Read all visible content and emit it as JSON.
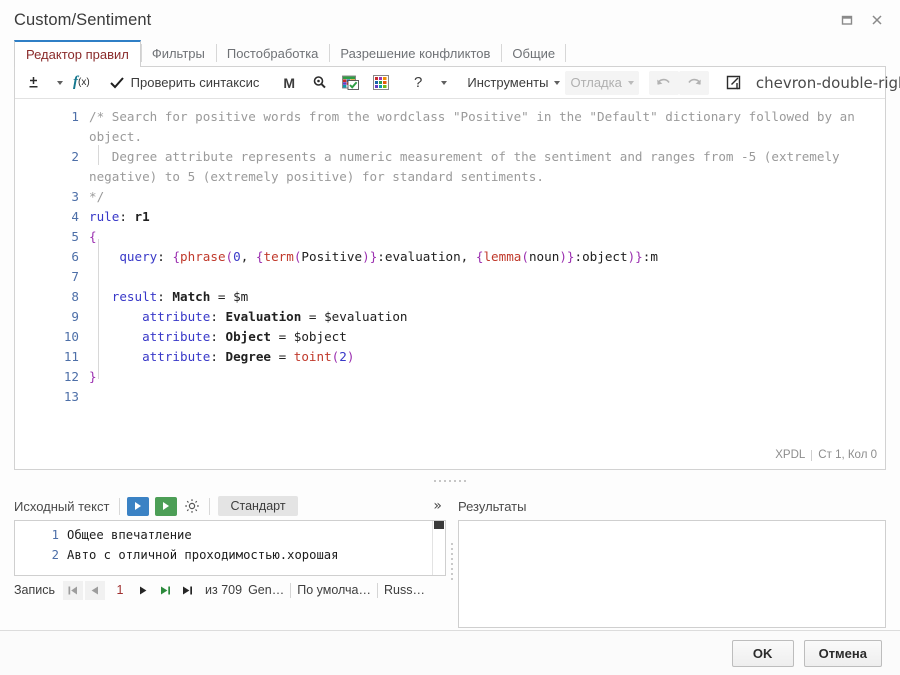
{
  "window": {
    "title": "Custom/Sentiment",
    "restore_icon": "restore-window-icon",
    "close_icon": "close-icon"
  },
  "tabs": [
    {
      "label": "Редактор правил",
      "active": true
    },
    {
      "label": "Фильтры",
      "active": false
    },
    {
      "label": "Постобработка",
      "active": false
    },
    {
      "label": "Разрешение конфликтов",
      "active": false
    },
    {
      "label": "Общие",
      "active": false
    }
  ],
  "toolbar": {
    "plusminus_icon": "plus-minus-icon",
    "function_icon": "function-fx-icon",
    "check_syntax_label": "Проверить синтаксис",
    "check_icon": "checkmark-icon",
    "macro_icon": "M",
    "search_icon": "search-icon",
    "dictionary_icon": "dictionary-check-icon",
    "palette_icon": "color-grid-icon",
    "help_icon": "?",
    "tools_label": "Инструменты",
    "debug_label": "Отладка",
    "undo_icon": "undo-icon",
    "redo_icon": "redo-icon",
    "popout_icon": "open-external-icon",
    "overflow_icon": "chevron-double-right-icon",
    "panel_icon": "toggle-panel-icon"
  },
  "editor": {
    "status_language": "XPDL",
    "status_position": "Ст 1, Кол 0",
    "lines": [
      {
        "number": "1",
        "tokens": [
          {
            "t": "/* Search for positive words from the wordclass \"Positive\" in the \"Default\" dictionary followed by an object.",
            "c": "cmt"
          }
        ]
      },
      {
        "number": "2",
        "tokens": [
          {
            "t": "   Degree attribute represents a numeric measurement of the sentiment and ranges from -5 (extremely negative) to 5 (extremely positive) for standard sentiments.",
            "c": "cmt"
          }
        ]
      },
      {
        "number": "3",
        "tokens": [
          {
            "t": "*/",
            "c": "cmt"
          }
        ]
      },
      {
        "number": "4",
        "tokens": [
          {
            "t": "rule",
            "c": "kw"
          },
          {
            "t": ": ",
            "c": "plain"
          },
          {
            "t": "r1",
            "c": "bold-id"
          }
        ]
      },
      {
        "number": "5",
        "tokens": [
          {
            "t": "{",
            "c": "punct"
          }
        ]
      },
      {
        "number": "6",
        "tokens": [
          {
            "t": "    ",
            "c": "plain"
          },
          {
            "t": "query",
            "c": "kw"
          },
          {
            "t": ": ",
            "c": "plain"
          },
          {
            "t": "{",
            "c": "punct"
          },
          {
            "t": "phrase",
            "c": "fn"
          },
          {
            "t": "(",
            "c": "punct"
          },
          {
            "t": "0",
            "c": "num"
          },
          {
            "t": ", ",
            "c": "plain"
          },
          {
            "t": "{",
            "c": "punct"
          },
          {
            "t": "term",
            "c": "fn"
          },
          {
            "t": "(",
            "c": "punct"
          },
          {
            "t": "Positive",
            "c": "plain"
          },
          {
            "t": ")",
            "c": "punct"
          },
          {
            "t": "}",
            "c": "punct"
          },
          {
            "t": ":evaluation, ",
            "c": "plain"
          },
          {
            "t": "{",
            "c": "punct"
          },
          {
            "t": "lemma",
            "c": "fn"
          },
          {
            "t": "(",
            "c": "punct"
          },
          {
            "t": "noun",
            "c": "plain"
          },
          {
            "t": ")",
            "c": "punct"
          },
          {
            "t": "}",
            "c": "punct"
          },
          {
            "t": ":object",
            "c": "plain"
          },
          {
            "t": ")",
            "c": "punct"
          },
          {
            "t": "}",
            "c": "punct"
          },
          {
            "t": ":m",
            "c": "plain"
          }
        ]
      },
      {
        "number": "7",
        "tokens": []
      },
      {
        "number": "8",
        "tokens": [
          {
            "t": "   ",
            "c": "plain"
          },
          {
            "t": "result",
            "c": "kw"
          },
          {
            "t": ": ",
            "c": "plain"
          },
          {
            "t": "Match",
            "c": "bold-id"
          },
          {
            "t": " = ",
            "c": "plain"
          },
          {
            "t": "$m",
            "c": "var"
          }
        ]
      },
      {
        "number": "9",
        "tokens": [
          {
            "t": "       ",
            "c": "plain"
          },
          {
            "t": "attribute",
            "c": "kw"
          },
          {
            "t": ": ",
            "c": "plain"
          },
          {
            "t": "Evaluation",
            "c": "bold-id"
          },
          {
            "t": " = ",
            "c": "plain"
          },
          {
            "t": "$evaluation",
            "c": "var"
          }
        ]
      },
      {
        "number": "10",
        "tokens": [
          {
            "t": "       ",
            "c": "plain"
          },
          {
            "t": "attribute",
            "c": "kw"
          },
          {
            "t": ": ",
            "c": "plain"
          },
          {
            "t": "Object",
            "c": "bold-id"
          },
          {
            "t": " = ",
            "c": "plain"
          },
          {
            "t": "$object",
            "c": "var"
          }
        ]
      },
      {
        "number": "11",
        "tokens": [
          {
            "t": "       ",
            "c": "plain"
          },
          {
            "t": "attribute",
            "c": "kw"
          },
          {
            "t": ": ",
            "c": "plain"
          },
          {
            "t": "Degree",
            "c": "bold-id"
          },
          {
            "t": " = ",
            "c": "plain"
          },
          {
            "t": "toint",
            "c": "fn"
          },
          {
            "t": "(",
            "c": "punct"
          },
          {
            "t": "2",
            "c": "num"
          },
          {
            "t": ")",
            "c": "punct"
          }
        ]
      },
      {
        "number": "12",
        "tokens": [
          {
            "t": "}",
            "c": "punct"
          }
        ]
      },
      {
        "number": "13",
        "tokens": []
      }
    ]
  },
  "source_panel": {
    "title": "Исходный текст",
    "run_icon": "run-icon",
    "run_step_icon": "run-step-icon",
    "settings_icon": "gear-icon",
    "preset_label": "Стандарт",
    "overflow_icon": "chevron-double-right-icon",
    "lines": [
      {
        "number": "1",
        "text": "Общее впечатление"
      },
      {
        "number": "2",
        "text": "Авто с отличной проходимостью.хорошая"
      }
    ]
  },
  "record_bar": {
    "label": "Запись",
    "first_icon": "go-first-icon",
    "prev_icon": "go-previous-icon",
    "current": "1",
    "next_icon": "go-next-icon",
    "last_new_icon": "go-last-green-icon",
    "last_icon": "go-last-icon",
    "total": "из 709",
    "generator": "Gen…",
    "default_label": "По умолча…",
    "language_label": "Russ…"
  },
  "results_panel": {
    "title": "Результаты",
    "content": ""
  },
  "footer": {
    "ok_label": "OK",
    "cancel_label": "Отмена"
  },
  "colors": {
    "accent_blue": "#2f7fc6",
    "active_tab_text": "#8a2b2b",
    "keyword": "#3838c8",
    "function": "#c0392b",
    "punct": "#9b30b0",
    "comment": "#9a9a9a",
    "gutter": "#4d6fa8",
    "run_blue": "#3b82c4",
    "run_green": "#4c9e56",
    "record_num": "#a03030"
  }
}
